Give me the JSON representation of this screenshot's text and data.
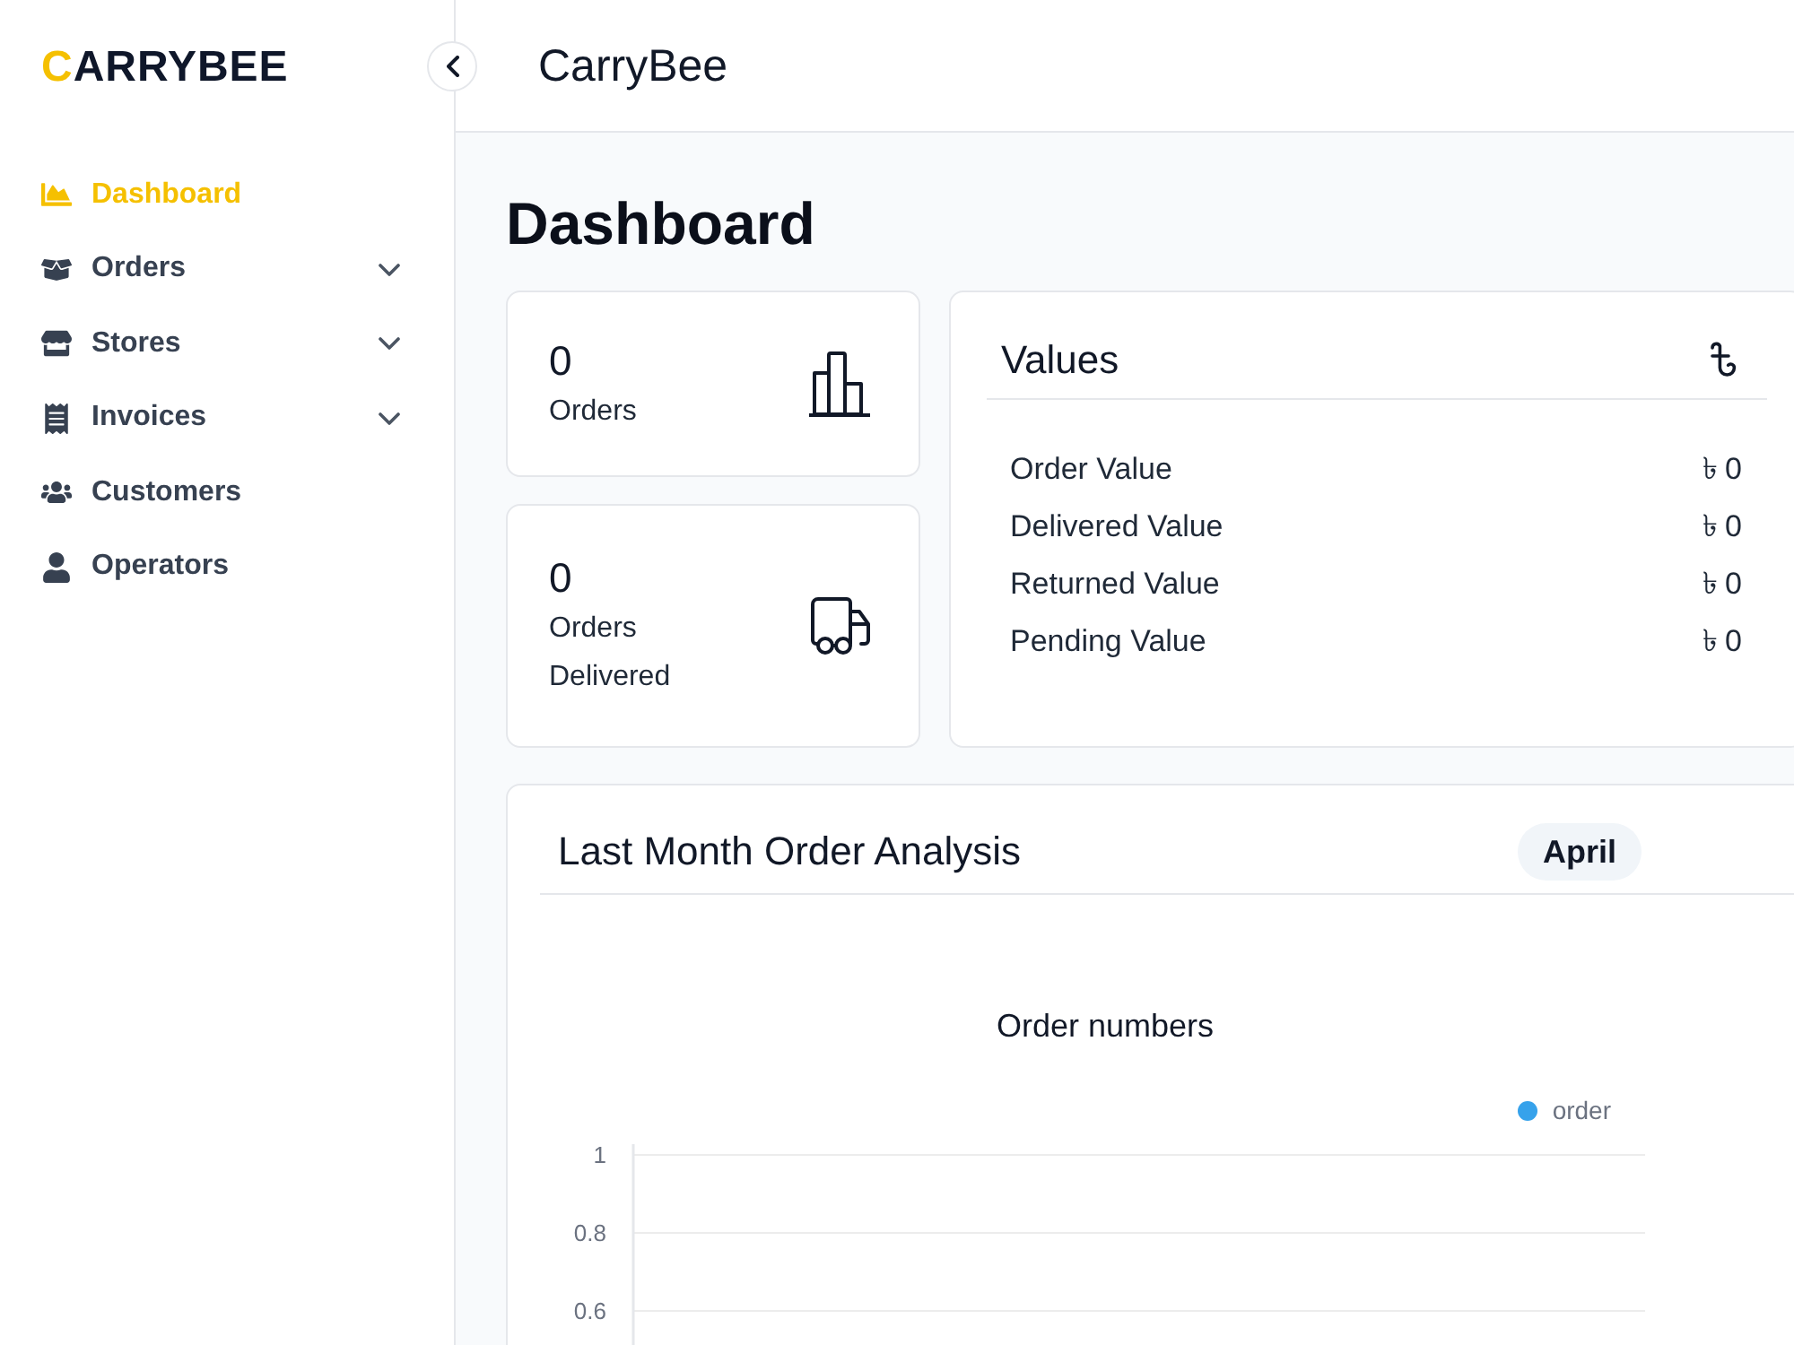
{
  "sidebar": {
    "logo": "CARRYBEE",
    "items": [
      {
        "label": "Dashboard",
        "selected": true,
        "expandable": false
      },
      {
        "label": "Orders",
        "selected": false,
        "expandable": true
      },
      {
        "label": "Stores",
        "selected": false,
        "expandable": true
      },
      {
        "label": "Invoices",
        "selected": false,
        "expandable": true
      },
      {
        "label": "Customers",
        "selected": false,
        "expandable": false
      },
      {
        "label": "Operators",
        "selected": false,
        "expandable": false
      }
    ]
  },
  "topbar": {
    "title": "CarryBee"
  },
  "page": {
    "heading": "Dashboard"
  },
  "stats": [
    {
      "value": "0",
      "label": "Orders"
    },
    {
      "value": "0",
      "label": "Orders Delivered"
    }
  ],
  "values_card": {
    "title": "Values",
    "rows": [
      {
        "label": "Order Value",
        "value": "৳ 0"
      },
      {
        "label": "Delivered Value",
        "value": "৳ 0"
      },
      {
        "label": "Returned Value",
        "value": "৳ 0"
      },
      {
        "label": "Pending Value",
        "value": "৳ 0"
      }
    ]
  },
  "analysis_card": {
    "title": "Last Month Order Analysis",
    "month": "April",
    "chart_data": {
      "type": "line",
      "title": "Order numbers",
      "series": [
        {
          "name": "order",
          "color": "#36a2eb"
        }
      ],
      "ylim": [
        0.6,
        1
      ],
      "yticks": [
        1,
        0.8,
        0.6
      ]
    }
  }
}
